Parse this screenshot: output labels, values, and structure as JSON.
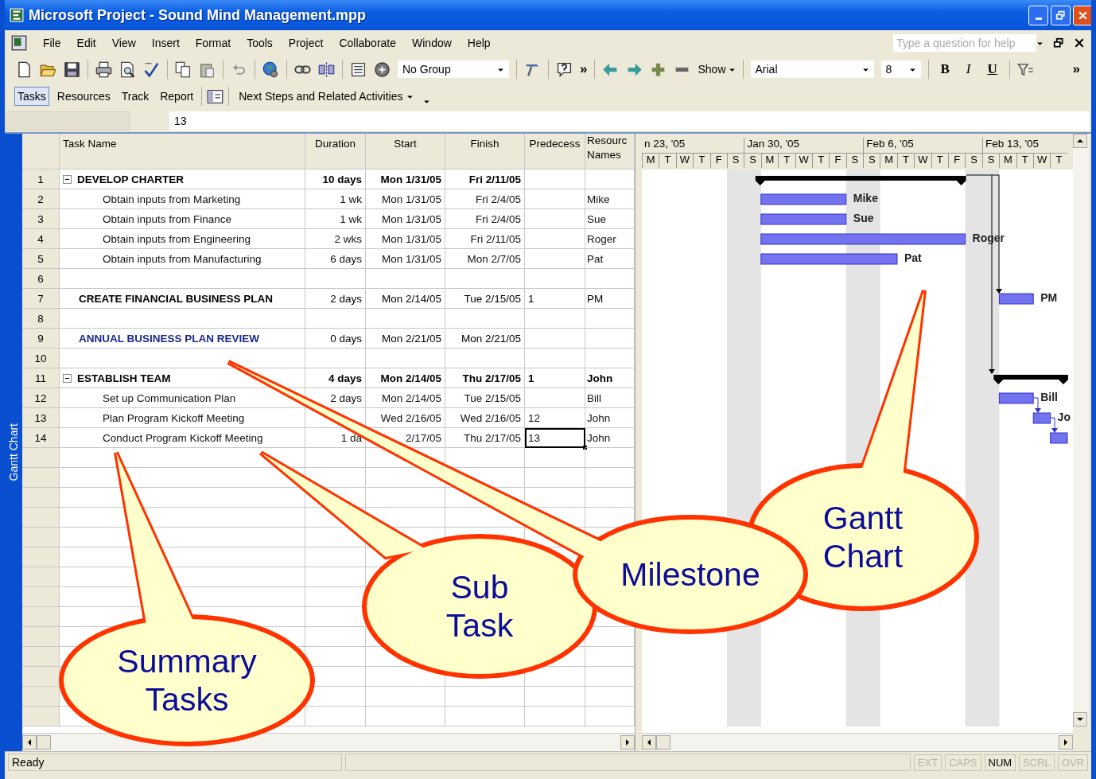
{
  "window": {
    "title": "Microsoft Project - Sound Mind Management.mpp"
  },
  "menu": [
    "File",
    "Edit",
    "View",
    "Insert",
    "Format",
    "Tools",
    "Project",
    "Collaborate",
    "Window",
    "Help"
  ],
  "help_search": {
    "placeholder": "Type a question for help"
  },
  "toolbar": {
    "group_select": "No Group",
    "overflow": "»",
    "show": "Show",
    "font": "Arial",
    "size": "8",
    "bold": "B",
    "italic": "I",
    "underline": "U",
    "overflow_end": "»"
  },
  "task_toolbar": {
    "tabs": [
      {
        "label": "Tasks",
        "selected": true
      },
      {
        "label": "Resources",
        "selected": false
      },
      {
        "label": "Track",
        "selected": false
      },
      {
        "label": "Report",
        "selected": false
      }
    ],
    "guide": "Next Steps and Related Activities"
  },
  "entry_bar": {
    "value": "13"
  },
  "view_bar": {
    "label": "Gantt Chart"
  },
  "table": {
    "columns": [
      "Task Name",
      "Duration",
      "Start",
      "Finish",
      "Predecess",
      "Resourc Names"
    ],
    "rows": [
      {
        "id": "1",
        "kind": "summary",
        "name": "DEVELOP CHARTER",
        "duration": "10 days",
        "start": "Mon 1/31/05",
        "finish": "Fri 2/11/05",
        "expanded": true,
        "active": false,
        "children": [
          {
            "id": "2",
            "kind": "task",
            "name": "Obtain inputs from Marketing",
            "duration": "1 wk",
            "start": "Mon 1/31/05",
            "finish": "Fri 2/4/05",
            "resource": "Mike",
            "active": false
          },
          {
            "id": "3",
            "kind": "task",
            "name": "Obtain inputs from Finance",
            "duration": "1 wk",
            "start": "Mon 1/31/05",
            "finish": "Fri 2/4/05",
            "resource": "Sue",
            "active": false
          },
          {
            "id": "4",
            "kind": "task",
            "name": "Obtain inputs from Engineering",
            "duration": "2 wks",
            "start": "Mon 1/31/05",
            "finish": "Fri 2/11/05",
            "resource": "Roger",
            "active": false
          },
          {
            "id": "5",
            "kind": "task",
            "name": "Obtain inputs from Manufacturing",
            "duration": "6 days",
            "start": "Mon 1/31/05",
            "finish": "Mon 2/7/05",
            "resource": "Pat",
            "active": false
          }
        ]
      },
      {
        "id": "6",
        "active": false
      },
      {
        "id": "7",
        "kind": "phase",
        "name": "CREATE FINANCIAL BUSINESS PLAN",
        "duration": "2 days",
        "start": "Mon 2/14/05",
        "finish": "Tue 2/15/05",
        "predecessors": "1",
        "resource": "PM",
        "active": false
      },
      {
        "id": "8",
        "active": false
      },
      {
        "id": "9",
        "kind": "milestone",
        "name": "ANNUAL BUSINESS PLAN REVIEW",
        "duration": "0 days",
        "start": "Mon 2/21/05",
        "finish": "Mon 2/21/05",
        "active": false
      },
      {
        "id": "10",
        "active": false
      },
      {
        "id": "11",
        "kind": "summary",
        "name": "ESTABLISH TEAM",
        "duration": "4 days",
        "start": "Mon 2/14/05",
        "finish": "Thu 2/17/05",
        "predecessors": "1",
        "resource": "John",
        "expanded": true,
        "active": false,
        "children": [
          {
            "id": "12",
            "kind": "task",
            "name": "Set up Communication Plan",
            "duration": "2 days",
            "start": "Mon 2/14/05",
            "finish": "Tue 2/15/05",
            "resource": "Bill",
            "active": false
          },
          {
            "id": "13",
            "kind": "task",
            "name": "Plan Program Kickoff Meeting",
            "start": "Wed 2/16/05",
            "finish": "Wed 2/16/05",
            "predecessors": "12",
            "resource": "John",
            "active": false
          },
          {
            "id": "14",
            "kind": "task",
            "name": "Conduct Program Kickoff Meeting",
            "duration": "1 da",
            "start": "2/17/05",
            "finish": "Thu 2/17/05",
            "predecessors": "13",
            "resource": "John",
            "active": true
          }
        ]
      }
    ]
  },
  "gantt": {
    "weeks": [
      {
        "label": "n 23, '05",
        "days": [
          "M",
          "T",
          "W",
          "T",
          "F",
          "S"
        ]
      },
      {
        "label": "Jan 30, '05",
        "days": [
          "S",
          "M",
          "T",
          "W",
          "T",
          "F",
          "S"
        ]
      },
      {
        "label": "Feb 6, '05",
        "days": [
          "S",
          "M",
          "T",
          "W",
          "T",
          "F",
          "S"
        ]
      },
      {
        "label": "Feb 13, '05",
        "days": [
          "S",
          "M",
          "T",
          "W",
          "T"
        ]
      }
    ],
    "bars": [
      {
        "kind": "summary"
      },
      {
        "kind": "task",
        "label": "Mike"
      },
      {
        "kind": "task",
        "label": "Sue"
      },
      {
        "kind": "task",
        "label": "Roger"
      },
      {
        "kind": "task",
        "label": "Pat"
      },
      {
        "kind": "task",
        "label": "PM"
      },
      {
        "kind": "summary"
      },
      {
        "kind": "task",
        "label": "Bill"
      },
      {
        "kind": "task",
        "label": "Jo"
      },
      {
        "kind": "task"
      }
    ]
  },
  "callouts": [
    {
      "text": "Gantt Chart"
    },
    {
      "text": "Sub Task"
    },
    {
      "text": "Milestone"
    },
    {
      "text": "Summary Tasks"
    }
  ],
  "status_bar": {
    "text": "Ready",
    "indicators": [
      {
        "label": "EXT",
        "on": false
      },
      {
        "label": "CAPS",
        "on": false
      },
      {
        "label": "NUM",
        "on": true
      },
      {
        "label": "SCRL",
        "on": false
      },
      {
        "label": "OVR",
        "on": false
      }
    ]
  }
}
